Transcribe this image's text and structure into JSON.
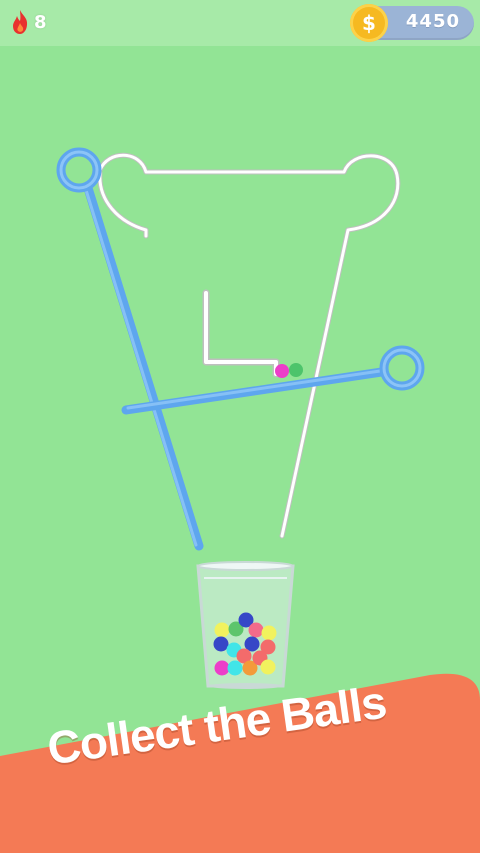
{
  "hud": {
    "level_icon": "flame-icon",
    "level_count": "8",
    "coin_icon": "dollar-coin-icon",
    "coin_symbol": "$",
    "coin_count": "4450"
  },
  "banner": {
    "text": "Collect the Balls",
    "color": "#f47a55"
  },
  "colors": {
    "background": "#92e495",
    "pin": "#6aaef2",
    "funnel_outline": "#ffffff",
    "cup_glass": "#d9ecec"
  },
  "balls_in_play": [
    "magenta",
    "green"
  ],
  "cup_ball_colors": [
    "yellow",
    "green",
    "blue",
    "pink",
    "yellow",
    "blue",
    "cyan",
    "blue",
    "red",
    "red",
    "magenta",
    "cyan",
    "orange",
    "red",
    "yellow"
  ]
}
